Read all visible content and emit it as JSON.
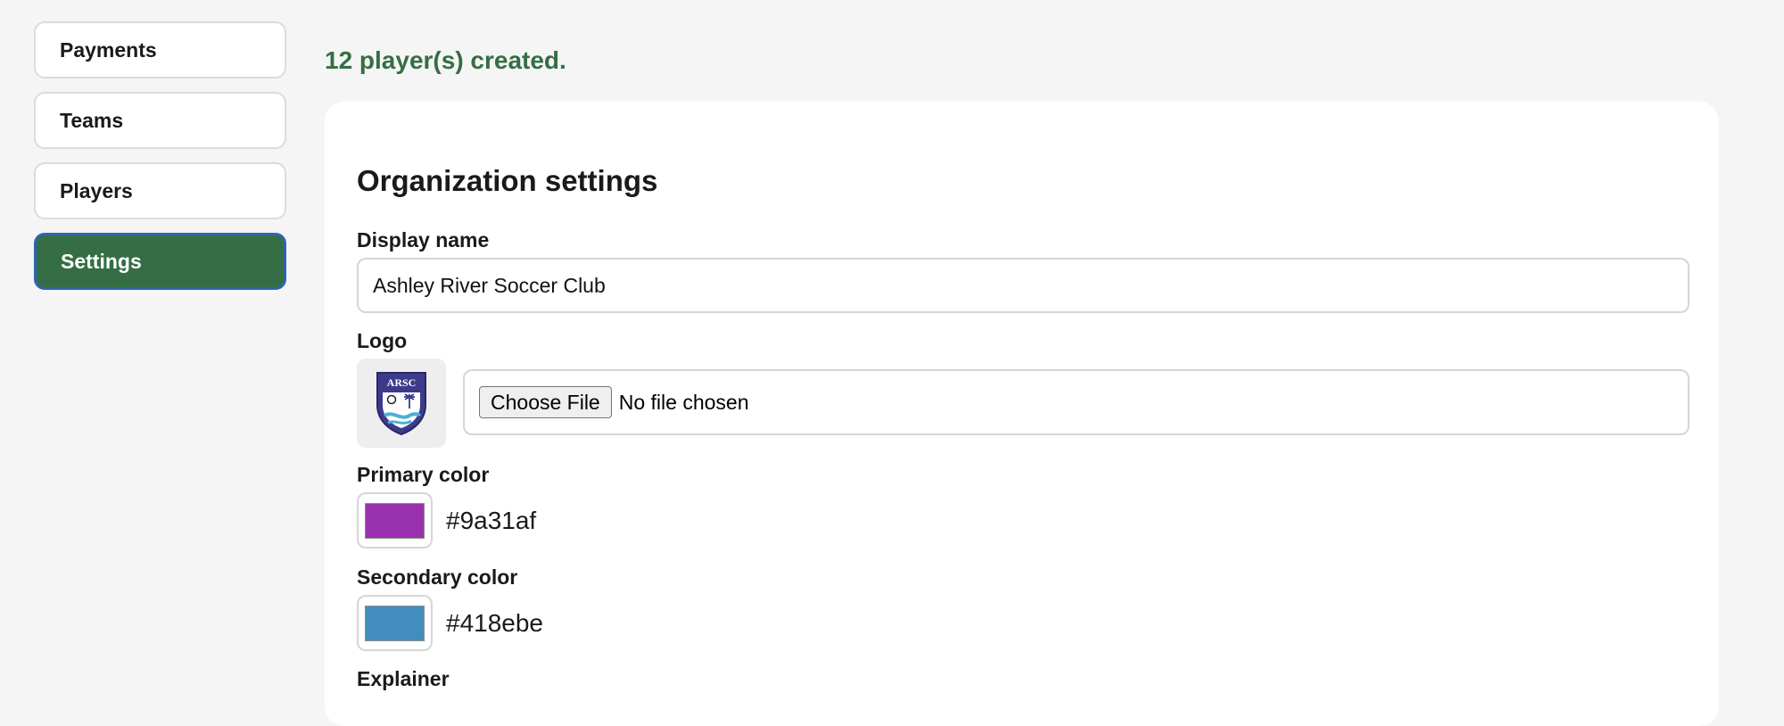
{
  "sidebar": {
    "items": [
      {
        "label": "Payments"
      },
      {
        "label": "Teams"
      },
      {
        "label": "Players"
      },
      {
        "label": "Settings",
        "active": true
      }
    ]
  },
  "flash": {
    "message": "12 player(s) created."
  },
  "settings": {
    "title": "Organization settings",
    "display_name": {
      "label": "Display name",
      "value": "Ashley River Soccer Club"
    },
    "logo": {
      "label": "Logo",
      "logo_text": "ARSC",
      "choose_button": "Choose File",
      "file_status": "No file chosen"
    },
    "primary_color": {
      "label": "Primary color",
      "value": "#9a31af"
    },
    "secondary_color": {
      "label": "Secondary color",
      "value": "#418ebe"
    },
    "explainer": {
      "label": "Explainer"
    }
  },
  "colors": {
    "accent": "#356e44",
    "active_border": "#2f64b0",
    "logo_shield": "#3d3a8c"
  }
}
